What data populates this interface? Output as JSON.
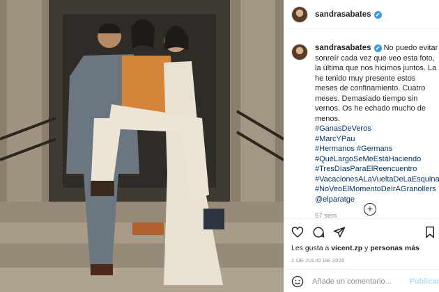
{
  "post": {
    "username": "sandrasabates",
    "verified_mark": "✔",
    "caption": "No puedo evitar sonreír cada vez que veo esta foto, la última que nos hicimos juntos. La he tenido muy presente estos meses de confinamiento. Cuatro meses. Demasiado tiempo sin vernos. Os he echado mucho de menos.",
    "hashtags": [
      "#GanasDeVeros",
      "#MarcYPau",
      "#Hermanos #Germans",
      "#QuéLargoSeMeEstáHaciendo",
      "#TresDíasParaElReencuentro",
      "#VacacionesALaVueltaDeLaEsquina",
      "#NoVeoElMomentoDeIrAGranollers",
      "@elparatge"
    ],
    "time_ago": "57 sem",
    "likes_prefix": "Les gusta a ",
    "likes_user": "vicent.zp",
    "likes_suffix": " y ",
    "likes_others": "personas más",
    "date": "1 DE JULIO DE 2020"
  },
  "actions": {
    "icons": [
      "heart-icon",
      "comment-icon",
      "share-icon",
      "bookmark-icon",
      "emoji-icon",
      "plus-icon"
    ],
    "more_plus": "+"
  },
  "comment_box": {
    "placeholder": "Añade un comentario...",
    "publish_label": "Publicar"
  },
  "colors": {
    "link": "#00376b",
    "verified": "#3897f0",
    "muted": "#8e8e8e",
    "publish": "#b2dffc"
  }
}
